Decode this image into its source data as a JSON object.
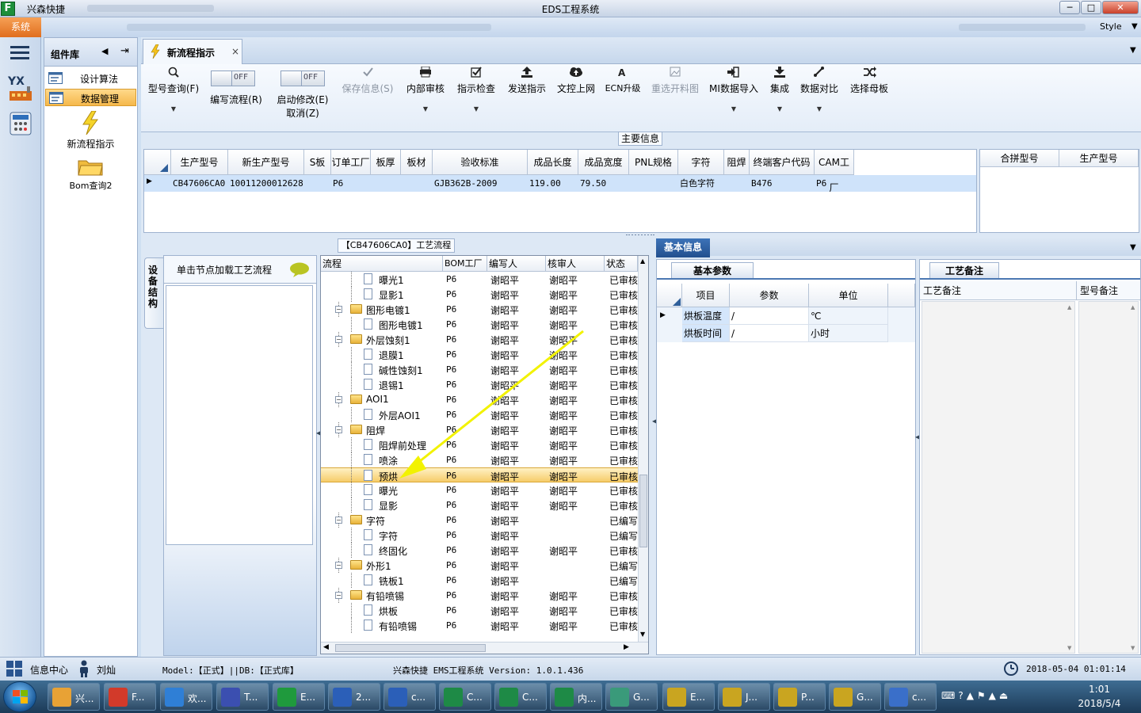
{
  "app": {
    "name": "兴森快捷",
    "window_title": "EDS工程系统",
    "logo_letter": "F"
  },
  "window_controls": {
    "minimize": "─",
    "maximize": "□",
    "close": "✕"
  },
  "menu": {
    "system": "系统",
    "style": "Style"
  },
  "component_panel": {
    "title": "组件库",
    "items": [
      {
        "label": "设计算法",
        "selected": false
      },
      {
        "label": "数据管理",
        "selected": true
      }
    ],
    "launchers": [
      {
        "label": "新流程指示",
        "icon": "lightning-icon"
      },
      {
        "label": "Bom查询2",
        "icon": "folder-icon"
      }
    ]
  },
  "left_rail": {
    "logo_text": "YX"
  },
  "tab": {
    "label": "新流程指示",
    "close": "×"
  },
  "ribbon": {
    "buttons": [
      {
        "label": "型号查询(F)",
        "icon": "search-icon",
        "disabled": false,
        "dropdown": true
      },
      {
        "label": "保存信息(S)",
        "icon": "check-icon",
        "disabled": true,
        "dropdown": false
      },
      {
        "label": "内部审核",
        "icon": "printer-icon",
        "disabled": false,
        "dropdown": true
      },
      {
        "label": "指示检查",
        "icon": "checkbox-icon",
        "disabled": false,
        "dropdown": true
      },
      {
        "label": "发送指示",
        "icon": "upload-icon",
        "disabled": false,
        "dropdown": false
      },
      {
        "label": "文控上网",
        "icon": "cloud-upload-icon",
        "disabled": false,
        "dropdown": false
      },
      {
        "label": "ECN升级",
        "icon": "ecn-icon",
        "disabled": false,
        "dropdown": false
      },
      {
        "label": "重选开料图",
        "icon": "image-icon",
        "disabled": true,
        "dropdown": false
      },
      {
        "label": "MI数据导入",
        "icon": "import-icon",
        "disabled": false,
        "dropdown": true
      },
      {
        "label": "集成",
        "icon": "download-icon",
        "disabled": false,
        "dropdown": true
      },
      {
        "label": "数据对比",
        "icon": "compare-icon",
        "disabled": false,
        "dropdown": true
      },
      {
        "label": "选择母板",
        "icon": "shuffle-icon",
        "disabled": false,
        "dropdown": false
      }
    ],
    "toggles": [
      {
        "label": "编写流程(R)",
        "state": "OFF"
      },
      {
        "label": "启动修改(E)",
        "sublabel": "取消(Z)",
        "state": "OFF"
      }
    ]
  },
  "main_info": {
    "title": "主要信息",
    "columns": [
      "生产型号",
      "新生产型号",
      "S板",
      "订单工厂",
      "板厚",
      "板材",
      "验收标准",
      "成品长度",
      "成品宽度",
      "PNL规格",
      "字符",
      "阻焊",
      "终端客户代码",
      "CAM工厂"
    ],
    "row": [
      "CB47606CA0",
      "10011200012628",
      "",
      "P6",
      "",
      "",
      "GJB362B-2009",
      "119.00",
      "79.50",
      "",
      "白色字符",
      "",
      "B476",
      "P6"
    ],
    "merge_columns": [
      "合拼型号",
      "生产型号"
    ]
  },
  "node_panel": {
    "side_tab": "设备结构",
    "hint": "单击节点加载工艺流程"
  },
  "flow": {
    "title": "【CB47606CA0】工艺流程",
    "columns": [
      "流程",
      "BOM工厂",
      "编写人",
      "核审人",
      "状态"
    ],
    "rows": [
      {
        "name": "曝光1",
        "level": 2,
        "bom": "P6",
        "author": "谢昭平",
        "reviewer": "谢昭平",
        "status": "已审核"
      },
      {
        "name": "显影1",
        "level": 2,
        "bom": "P6",
        "author": "谢昭平",
        "reviewer": "谢昭平",
        "status": "已审核"
      },
      {
        "name": "图形电镀1",
        "level": 1,
        "bom": "P6",
        "author": "谢昭平",
        "reviewer": "谢昭平",
        "status": "已审核"
      },
      {
        "name": "图形电镀1",
        "level": 2,
        "bom": "P6",
        "author": "谢昭平",
        "reviewer": "谢昭平",
        "status": "已审核"
      },
      {
        "name": "外层蚀刻1",
        "level": 1,
        "bom": "P6",
        "author": "谢昭平",
        "reviewer": "谢昭平",
        "status": "已审核"
      },
      {
        "name": "退膜1",
        "level": 2,
        "bom": "P6",
        "author": "谢昭平",
        "reviewer": "谢昭平",
        "status": "已审核"
      },
      {
        "name": "碱性蚀刻1",
        "level": 2,
        "bom": "P6",
        "author": "谢昭平",
        "reviewer": "谢昭平",
        "status": "已审核"
      },
      {
        "name": "退锡1",
        "level": 2,
        "bom": "P6",
        "author": "谢昭平",
        "reviewer": "谢昭平",
        "status": "已审核"
      },
      {
        "name": "AOI1",
        "level": 1,
        "bom": "P6",
        "author": "谢昭平",
        "reviewer": "谢昭平",
        "status": "已审核"
      },
      {
        "name": "外层AOI1",
        "level": 2,
        "bom": "P6",
        "author": "谢昭平",
        "reviewer": "谢昭平",
        "status": "已审核"
      },
      {
        "name": "阻焊",
        "level": 1,
        "bom": "P6",
        "author": "谢昭平",
        "reviewer": "谢昭平",
        "status": "已审核"
      },
      {
        "name": "阻焊前处理",
        "level": 2,
        "bom": "P6",
        "author": "谢昭平",
        "reviewer": "谢昭平",
        "status": "已审核"
      },
      {
        "name": "喷涂",
        "level": 2,
        "bom": "P6",
        "author": "谢昭平",
        "reviewer": "谢昭平",
        "status": "已审核"
      },
      {
        "name": "预烘",
        "level": 2,
        "bom": "P6",
        "author": "谢昭平",
        "reviewer": "谢昭平",
        "status": "已审核",
        "selected": true
      },
      {
        "name": "曝光",
        "level": 2,
        "bom": "P6",
        "author": "谢昭平",
        "reviewer": "谢昭平",
        "status": "已审核"
      },
      {
        "name": "显影",
        "level": 2,
        "bom": "P6",
        "author": "谢昭平",
        "reviewer": "谢昭平",
        "status": "已审核"
      },
      {
        "name": "字符",
        "level": 1,
        "bom": "P6",
        "author": "谢昭平",
        "reviewer": "",
        "status": "已编写"
      },
      {
        "name": "字符",
        "level": 2,
        "bom": "P6",
        "author": "谢昭平",
        "reviewer": "",
        "status": "已编写"
      },
      {
        "name": "终固化",
        "level": 2,
        "bom": "P6",
        "author": "谢昭平",
        "reviewer": "谢昭平",
        "status": "已审核"
      },
      {
        "name": "外形1",
        "level": 1,
        "bom": "P6",
        "author": "谢昭平",
        "reviewer": "",
        "status": "已编写"
      },
      {
        "name": "铣板1",
        "level": 2,
        "bom": "P6",
        "author": "谢昭平",
        "reviewer": "",
        "status": "已编写"
      },
      {
        "name": "有铅喷锡",
        "level": 1,
        "bom": "P6",
        "author": "谢昭平",
        "reviewer": "谢昭平",
        "status": "已审核"
      },
      {
        "name": "烘板",
        "level": 2,
        "bom": "P6",
        "author": "谢昭平",
        "reviewer": "谢昭平",
        "status": "已审核"
      },
      {
        "name": "有铅喷锡",
        "level": 2,
        "bom": "P6",
        "author": "谢昭平",
        "reviewer": "谢昭平",
        "status": "已审核"
      }
    ]
  },
  "basic_info": {
    "tab": "基本信息",
    "params_tab": "基本参数",
    "columns": [
      "项目",
      "参数",
      "单位"
    ],
    "rows": [
      {
        "item": "烘板温度",
        "param": "/",
        "unit": "℃"
      },
      {
        "item": "烘板时间",
        "param": "/",
        "unit": "小时"
      }
    ]
  },
  "notes": {
    "tab": "工艺备注",
    "columns": [
      "工艺备注",
      "型号备注"
    ]
  },
  "status_bar": {
    "info_center": "信息中心",
    "user": "刘灿",
    "model": "Model:【正式】||DB:【正式库】",
    "product": "兴森快捷 EMS工程系统 Version: 1.0.1.436",
    "datetime": "2018-05-04 01:01:14"
  },
  "taskbar": {
    "items": [
      {
        "label": "兴...",
        "color": "#e8a235"
      },
      {
        "label": "F...",
        "color": "#d23a2a"
      },
      {
        "label": "欢...",
        "color": "#2f7fd6"
      },
      {
        "label": "T...",
        "color": "#3b4fb0"
      },
      {
        "label": "E...",
        "color": "#1f9a3d"
      },
      {
        "label": "2...",
        "color": "#2b5fb8"
      },
      {
        "label": "c...",
        "color": "#2b5fb8"
      },
      {
        "label": "C...",
        "color": "#1e8a46"
      },
      {
        "label": "C...",
        "color": "#1e8a46"
      },
      {
        "label": "内...",
        "color": "#1e8a46"
      },
      {
        "label": "G...",
        "color": "#3a9a7a"
      },
      {
        "label": "E...",
        "color": "#c9a520"
      },
      {
        "label": "J...",
        "color": "#c9a520"
      },
      {
        "label": "P...",
        "color": "#c9a520"
      },
      {
        "label": "G...",
        "color": "#c9a520"
      },
      {
        "label": "c...",
        "color": "#3a6fc9"
      }
    ],
    "time": "1:01",
    "date": "2018/5/4"
  }
}
